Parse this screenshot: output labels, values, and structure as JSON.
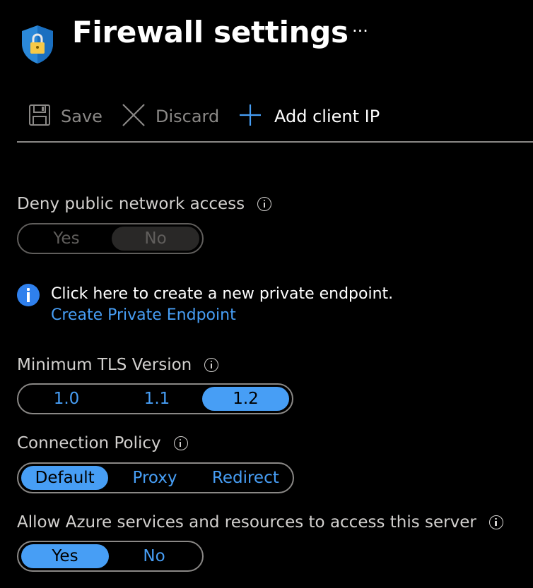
{
  "header": {
    "title": "Firewall settings",
    "more_label": "···",
    "icon": "shield-lock-icon"
  },
  "toolbar": {
    "save_label": "Save",
    "discard_label": "Discard",
    "add_client_ip_label": "Add client IP"
  },
  "deny_public_access": {
    "label": "Deny public network access",
    "options": [
      "Yes",
      "No"
    ],
    "selected": "No",
    "disabled": true
  },
  "info_banner": {
    "message": "Click here to create a new private endpoint.",
    "link": "Create Private Endpoint"
  },
  "min_tls": {
    "label": "Minimum TLS Version",
    "options": [
      "1.0",
      "1.1",
      "1.2"
    ],
    "selected": "1.2"
  },
  "connection_policy": {
    "label": "Connection Policy",
    "options": [
      "Default",
      "Proxy",
      "Redirect"
    ],
    "selected": "Default"
  },
  "allow_azure": {
    "label": "Allow Azure services and resources to access this server",
    "options": [
      "Yes",
      "No"
    ],
    "selected": "Yes"
  },
  "colors": {
    "accent": "#479ef5",
    "background": "#000000",
    "info_icon": "#2f80ed",
    "shield": "#2b88d8",
    "lock": "#f7c948"
  }
}
